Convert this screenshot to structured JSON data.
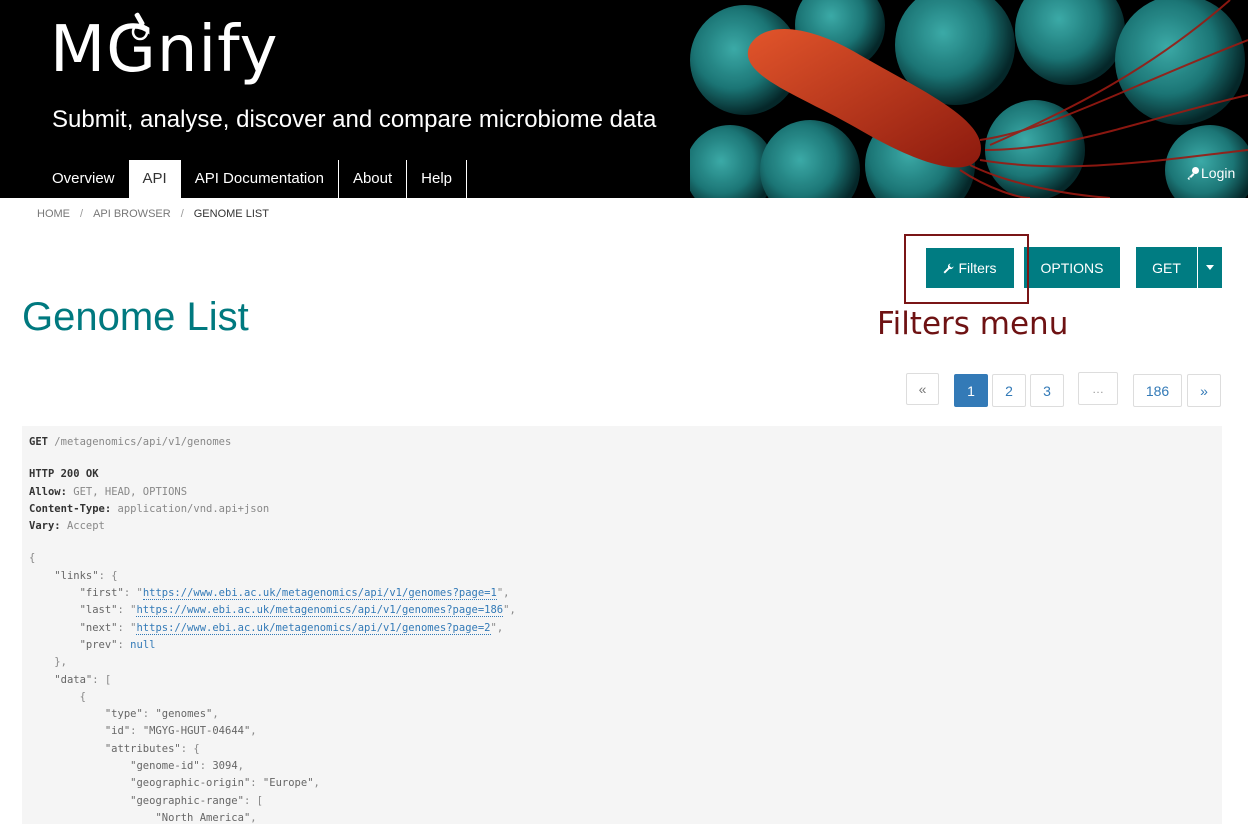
{
  "header": {
    "logo_text": "MGnify",
    "tagline": "Submit, analyse, discover and compare microbiome data",
    "nav": [
      "Overview",
      "API",
      "API Documentation",
      "About",
      "Help"
    ],
    "active_nav": "API",
    "login_label": "Login"
  },
  "breadcrumb": [
    "HOME",
    "API BROWSER",
    "GENOME LIST"
  ],
  "toolbar": {
    "filters_label": "Filters",
    "options_label": "OPTIONS",
    "get_label": "GET"
  },
  "annotation": "Filters menu",
  "page_title": "Genome List",
  "pagination": {
    "prev": "«",
    "pages": [
      "1",
      "2",
      "3"
    ],
    "current": "1",
    "ellipsis": "…",
    "last": "186",
    "next": "»"
  },
  "response": {
    "request_method": "GET",
    "request_path": "/metagenomics/api/v1/genomes",
    "status": "HTTP 200 OK",
    "headers": [
      {
        "name": "Allow:",
        "value": "GET, HEAD, OPTIONS"
      },
      {
        "name": "Content-Type:",
        "value": "application/vnd.api+json"
      },
      {
        "name": "Vary:",
        "value": "Accept"
      }
    ],
    "links": {
      "first": "https://www.ebi.ac.uk/metagenomics/api/v1/genomes?page=1",
      "last": "https://www.ebi.ac.uk/metagenomics/api/v1/genomes?page=186",
      "next": "https://www.ebi.ac.uk/metagenomics/api/v1/genomes?page=2",
      "prev": "null"
    },
    "item": {
      "type": "genomes",
      "id": "MGYG-HGUT-04644",
      "genome_id": "3094",
      "geographic_origin": "Europe",
      "geographic_range_first": "North America"
    }
  },
  "colors": {
    "brand_teal": "#007c82",
    "title_teal": "#00797f",
    "link_blue": "#337ab7",
    "annotation_red": "#6e1213"
  }
}
